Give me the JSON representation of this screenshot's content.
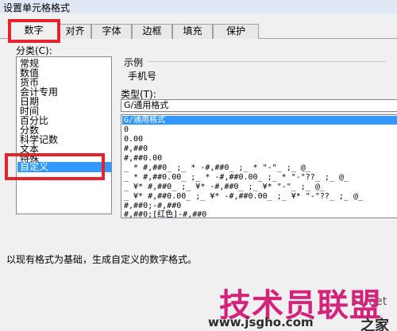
{
  "window": {
    "title": "设置单元格格式"
  },
  "tabs": [
    "数字",
    "对齐",
    "字体",
    "边框",
    "填充",
    "保护"
  ],
  "category": {
    "label": "分类(C):",
    "items": [
      "常规",
      "数值",
      "货币",
      "会计专用",
      "日期",
      "时间",
      "百分比",
      "分数",
      "科学记数",
      "文本",
      "特殊",
      "自定义"
    ],
    "selected": "自定义"
  },
  "sample": {
    "label": "示例",
    "value": "手机号"
  },
  "type": {
    "label": "类型(T):",
    "input_value": "G/通用格式",
    "items": [
      "G/通用格式",
      "0",
      "0.00",
      "#,##0",
      "#,##0.00",
      "_ * #,##0_ ;_ * -#,##0_ ;_ * \"-\"_ ;_ @_",
      "_ * #,##0.00_ ;_ * -#,##0.00_ ;_ * \"-\"??_ ;_ @_",
      "_ ¥* #,##0_ ;_ ¥* -#,##0_ ;_ ¥* \"-\"_ ;_ @_",
      "_ ¥* #,##0.00_ ;_ ¥* -#,##0.00_ ;_ ¥* \"-\"??_ ;_ @_",
      "#,##0;-#,##0",
      "#,##0;[红色]-#,##0"
    ],
    "selected": "G/通用格式"
  },
  "description": "以现有格式为基础，生成自定义的数字格式。",
  "watermark": {
    "brand": "技术员联盟",
    "url": "www.jsgho.com",
    "partial": "51.net",
    "home": "之家"
  },
  "colors": {
    "highlight": "#e4242c",
    "selection": "#3399ff",
    "watermark": "#d4237a"
  }
}
